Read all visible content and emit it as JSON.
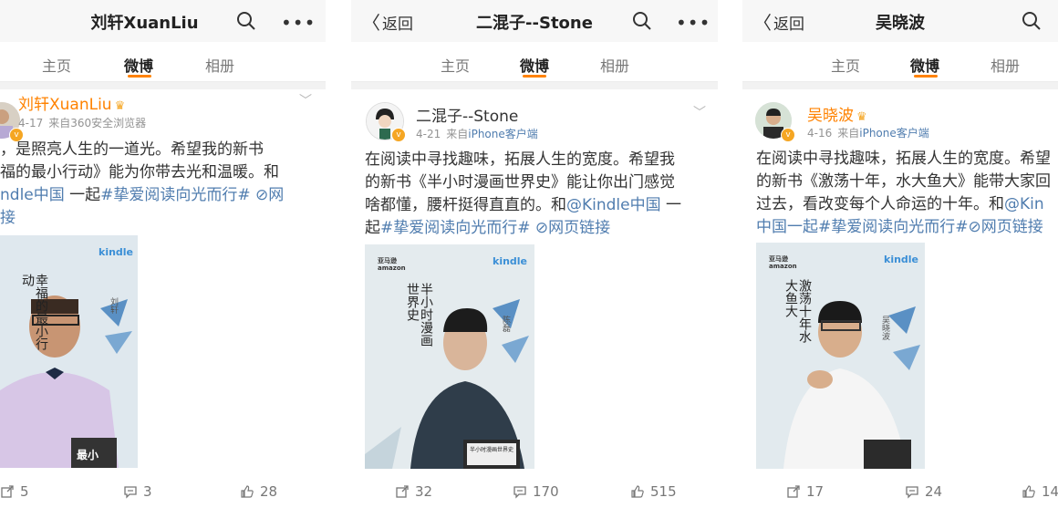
{
  "panels": [
    {
      "header_title": "刘轩XuanLiu",
      "tabs": [
        "主页",
        "微博",
        "相册"
      ],
      "user": "刘轩XuanLiu",
      "date": "4-17",
      "source": "来自360安全浏览器",
      "text": {
        "line1": "，是照亮人生的一道光。希望我的新书",
        "line2": "福的最小行动》能为你带去光和温暖。和",
        "line3a": "ndle中国",
        "line3b": " 一起",
        "line3c": "#挚爱阅读向光而行#",
        "line3d": " ⊘网",
        "line4": "接"
      },
      "poster": {
        "kindle": "kindle",
        "book": "幸福的最小行动",
        "author": "刘轩",
        "device_text": "最小"
      },
      "actions": {
        "repost": "5",
        "comment": "3",
        "like": "28"
      }
    },
    {
      "back_label": "返回",
      "header_title": "二混子--Stone",
      "tabs": [
        "主页",
        "微博",
        "相册"
      ],
      "user": "二混子--Stone",
      "date": "4-21",
      "source_prefix": "来自",
      "source_link": "iPhone客户端",
      "text": {
        "line1": "在阅读中寻找趣味，拓展人生的宽度。希望我",
        "line2": "的新书《半小时漫画世界史》能让你出门感觉",
        "line3": "啥都懂，腰杆挺得直直的。和",
        "line3_link": "@Kindle中国",
        "line3_end": " 一",
        "line4a": "起",
        "line4b": "#挚爱阅读向光而行#",
        "line4c": " ⊘网页链接"
      },
      "poster": {
        "amazon": "亚马逊 amazon",
        "kindle": "kindle",
        "book": "半小时漫画世界史",
        "author": "陈磊",
        "device_text": "半小时漫画世界史"
      },
      "actions": {
        "repost": "32",
        "comment": "170",
        "like": "515"
      }
    },
    {
      "back_label": "返回",
      "header_title": "吴晓波",
      "tabs": [
        "主页",
        "微博",
        "相册"
      ],
      "user": "吴晓波",
      "date": "4-16",
      "source_prefix": "来自",
      "source_link": "iPhone客户端",
      "text": {
        "line1": "在阅读中寻找趣味，拓展人生的宽度。希望",
        "line2": "的新书《激荡十年，水大鱼大》能带大家回",
        "line3a": "过去，看改变每个人命运的十年。和",
        "line3b": "@Kin",
        "line4a": "中国一起",
        "line4b": "#挚爱阅读向光而行#",
        "line4c": "⊘网页链接"
      },
      "poster": {
        "amazon": "亚马逊 amazon",
        "kindle": "kindle",
        "book": "激荡十年水大鱼大",
        "author": "吴晓波"
      },
      "actions": {
        "repost": "17",
        "comment": "24",
        "like": "14"
      }
    }
  ],
  "colors": {
    "accent": "#ff8200",
    "link": "#507daf",
    "meta": "#939393"
  }
}
